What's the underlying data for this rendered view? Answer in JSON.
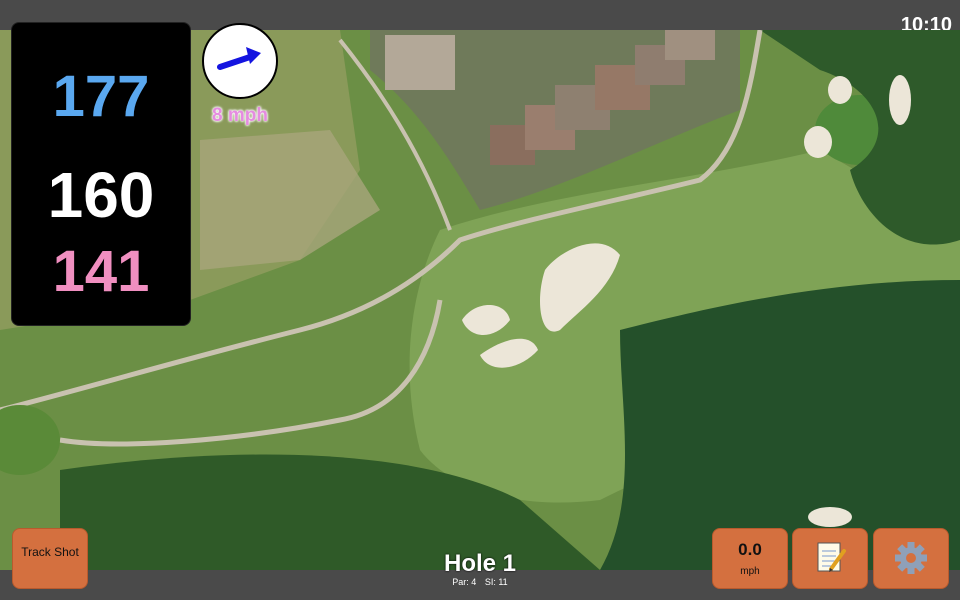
{
  "status_bar": {
    "time": "10:10"
  },
  "distances": {
    "back": "177",
    "middle": "160",
    "front": "141"
  },
  "wind": {
    "speed": "8 mph",
    "direction_icon": "arrow-right-icon"
  },
  "hole": {
    "title": "Hole 1",
    "par": "Par: 4",
    "stroke_index": "SI: 11"
  },
  "buttons": {
    "track_shot": "Track Shot",
    "speed_value": "0.0",
    "speed_unit": "mph",
    "notes_icon": "notepad-icon",
    "settings_icon": "gear-icon"
  },
  "colors": {
    "back_distance": "#5aa8f0",
    "middle_distance": "#ffffff",
    "front_distance": "#f08fc0",
    "wind_speed": "#e58ce0",
    "button": "#d4703f",
    "arrow": "#1414e0"
  }
}
